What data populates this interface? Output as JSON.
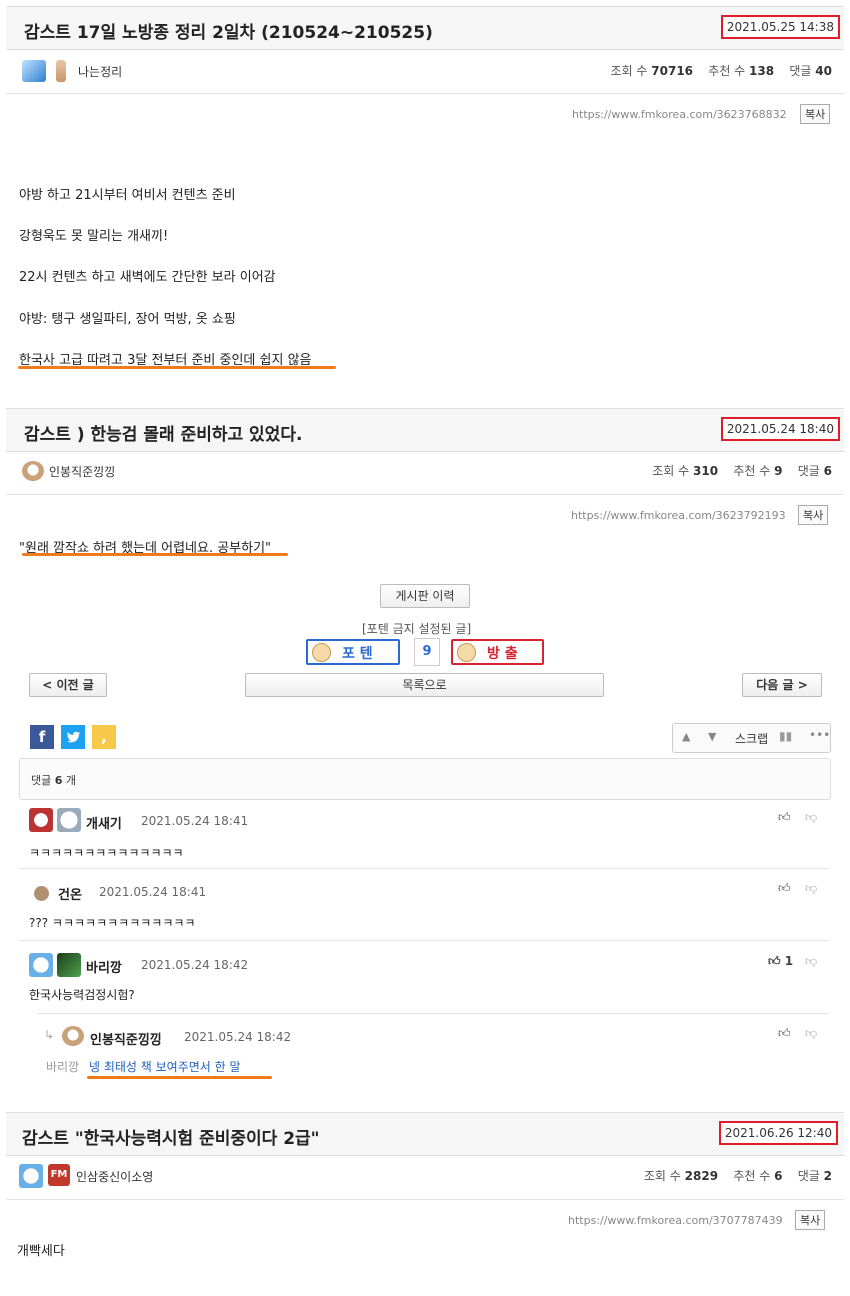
{
  "post1": {
    "title": "감스트 17일 노방종 정리 2일차 (210524~210525)",
    "date": "2021.05.25 14:38",
    "author": "나는정리",
    "views_label": "조회 수",
    "views": "70716",
    "likes_label": "추천 수",
    "likes": "138",
    "comments_label": "댓글",
    "comments": "40",
    "url": "https://www.fmkorea.com/3623768832",
    "copy": "복사",
    "lines": [
      "야방 하고 21시부터 여비서 컨텐츠 준비",
      "강형욱도 못 말리는 개새끼!",
      "22시 컨텐츠 하고 새벽에도 간단한 보라 이어감",
      "야방: 탱구 생일파티, 장어 먹방, 옷 쇼핑",
      "한국사 고급 따려고 3달 전부터 준비 중인데 쉽지 않음"
    ]
  },
  "post2": {
    "title": "감스트 ) 한능검 몰래 준비하고 있었다.",
    "date": "2021.05.24 18:40",
    "author": "인봉직준낑낑",
    "views_label": "조회 수",
    "views": "310",
    "likes_label": "추천 수",
    "likes": "9",
    "comments_label": "댓글",
    "comments": "6",
    "url": "https://www.fmkorea.com/3623792193",
    "copy": "복사",
    "quote": "\"원래 깜작쇼 하려 했는데 어렵네요. 공부하기\"",
    "board_history": "게시판 이력",
    "poten_notice": "[포텐 금지 설정된 글]",
    "poten": "포 텐",
    "vote_count": "9",
    "bangchul": "방 출",
    "prev": "< 이전 글",
    "list": "목록으로",
    "next": "다음 글 >",
    "scrap": "스크랩",
    "comment_count_label": "댓글",
    "comment_count": "6",
    "comment_count_suffix": "개",
    "comments_list": [
      {
        "nick": "개새기",
        "date": "2021.05.24 18:41",
        "text": "ㅋㅋㅋㅋㅋㅋㅋㅋㅋㅋㅋㅋㅋㅋ",
        "likes": ""
      },
      {
        "nick": "건온",
        "date": "2021.05.24 18:41",
        "text": "??? ㅋㅋㅋㅋㅋㅋㅋㅋㅋㅋㅋㅋㅋ",
        "likes": ""
      },
      {
        "nick": "바리깡",
        "date": "2021.05.24 18:42",
        "text": "한국사능력검정시험?",
        "likes": "1"
      },
      {
        "nick": "인봉직준낑낑",
        "date": "2021.05.24 18:42",
        "reply_to": "바리깡",
        "text": "넹 최태성 책 보여주면서 한 말",
        "likes": ""
      }
    ]
  },
  "post3": {
    "title": "감스트 \"한국사능력시험 준비중이다 2급\"",
    "date": "2021.06.26 12:40",
    "author": "인삼중신이소영",
    "views_label": "조회 수",
    "views": "2829",
    "likes_label": "추천 수",
    "likes": "6",
    "comments_label": "댓글",
    "comments": "2",
    "url": "https://www.fmkorea.com/3707787439",
    "copy": "복사",
    "body": "개빡세다"
  },
  "icons": [
    "facebook-icon",
    "twitter-icon",
    "kakao-icon",
    "thumbs-up-icon",
    "thumbs-down-icon",
    "arrow-up-icon",
    "arrow-down-icon",
    "chart-icon",
    "more-icon",
    "reply-arrow-icon"
  ],
  "colors": {
    "date_box": "#e01d2b",
    "underline": "#f27a1a",
    "poten_blue": "#2a6bd3",
    "bangchul_red": "#d9232e",
    "facebook": "#3b5998",
    "twitter": "#1da1f2",
    "kakao": "#f7c948",
    "link_blue": "#1f5fbf"
  }
}
